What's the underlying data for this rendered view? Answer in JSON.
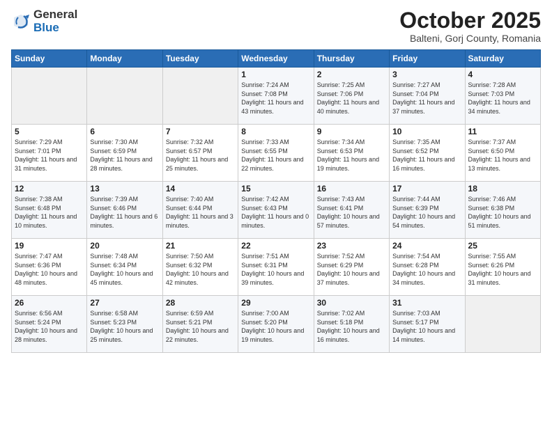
{
  "logo": {
    "general": "General",
    "blue": "Blue"
  },
  "header": {
    "month": "October 2025",
    "location": "Balteni, Gorj County, Romania"
  },
  "weekdays": [
    "Sunday",
    "Monday",
    "Tuesday",
    "Wednesday",
    "Thursday",
    "Friday",
    "Saturday"
  ],
  "weeks": [
    [
      {
        "day": "",
        "info": ""
      },
      {
        "day": "",
        "info": ""
      },
      {
        "day": "",
        "info": ""
      },
      {
        "day": "1",
        "info": "Sunrise: 7:24 AM\nSunset: 7:08 PM\nDaylight: 11 hours\nand 43 minutes."
      },
      {
        "day": "2",
        "info": "Sunrise: 7:25 AM\nSunset: 7:06 PM\nDaylight: 11 hours\nand 40 minutes."
      },
      {
        "day": "3",
        "info": "Sunrise: 7:27 AM\nSunset: 7:04 PM\nDaylight: 11 hours\nand 37 minutes."
      },
      {
        "day": "4",
        "info": "Sunrise: 7:28 AM\nSunset: 7:03 PM\nDaylight: 11 hours\nand 34 minutes."
      }
    ],
    [
      {
        "day": "5",
        "info": "Sunrise: 7:29 AM\nSunset: 7:01 PM\nDaylight: 11 hours\nand 31 minutes."
      },
      {
        "day": "6",
        "info": "Sunrise: 7:30 AM\nSunset: 6:59 PM\nDaylight: 11 hours\nand 28 minutes."
      },
      {
        "day": "7",
        "info": "Sunrise: 7:32 AM\nSunset: 6:57 PM\nDaylight: 11 hours\nand 25 minutes."
      },
      {
        "day": "8",
        "info": "Sunrise: 7:33 AM\nSunset: 6:55 PM\nDaylight: 11 hours\nand 22 minutes."
      },
      {
        "day": "9",
        "info": "Sunrise: 7:34 AM\nSunset: 6:53 PM\nDaylight: 11 hours\nand 19 minutes."
      },
      {
        "day": "10",
        "info": "Sunrise: 7:35 AM\nSunset: 6:52 PM\nDaylight: 11 hours\nand 16 minutes."
      },
      {
        "day": "11",
        "info": "Sunrise: 7:37 AM\nSunset: 6:50 PM\nDaylight: 11 hours\nand 13 minutes."
      }
    ],
    [
      {
        "day": "12",
        "info": "Sunrise: 7:38 AM\nSunset: 6:48 PM\nDaylight: 11 hours\nand 10 minutes."
      },
      {
        "day": "13",
        "info": "Sunrise: 7:39 AM\nSunset: 6:46 PM\nDaylight: 11 hours\nand 6 minutes."
      },
      {
        "day": "14",
        "info": "Sunrise: 7:40 AM\nSunset: 6:44 PM\nDaylight: 11 hours\nand 3 minutes."
      },
      {
        "day": "15",
        "info": "Sunrise: 7:42 AM\nSunset: 6:43 PM\nDaylight: 11 hours\nand 0 minutes."
      },
      {
        "day": "16",
        "info": "Sunrise: 7:43 AM\nSunset: 6:41 PM\nDaylight: 10 hours\nand 57 minutes."
      },
      {
        "day": "17",
        "info": "Sunrise: 7:44 AM\nSunset: 6:39 PM\nDaylight: 10 hours\nand 54 minutes."
      },
      {
        "day": "18",
        "info": "Sunrise: 7:46 AM\nSunset: 6:38 PM\nDaylight: 10 hours\nand 51 minutes."
      }
    ],
    [
      {
        "day": "19",
        "info": "Sunrise: 7:47 AM\nSunset: 6:36 PM\nDaylight: 10 hours\nand 48 minutes."
      },
      {
        "day": "20",
        "info": "Sunrise: 7:48 AM\nSunset: 6:34 PM\nDaylight: 10 hours\nand 45 minutes."
      },
      {
        "day": "21",
        "info": "Sunrise: 7:50 AM\nSunset: 6:32 PM\nDaylight: 10 hours\nand 42 minutes."
      },
      {
        "day": "22",
        "info": "Sunrise: 7:51 AM\nSunset: 6:31 PM\nDaylight: 10 hours\nand 39 minutes."
      },
      {
        "day": "23",
        "info": "Sunrise: 7:52 AM\nSunset: 6:29 PM\nDaylight: 10 hours\nand 37 minutes."
      },
      {
        "day": "24",
        "info": "Sunrise: 7:54 AM\nSunset: 6:28 PM\nDaylight: 10 hours\nand 34 minutes."
      },
      {
        "day": "25",
        "info": "Sunrise: 7:55 AM\nSunset: 6:26 PM\nDaylight: 10 hours\nand 31 minutes."
      }
    ],
    [
      {
        "day": "26",
        "info": "Sunrise: 6:56 AM\nSunset: 5:24 PM\nDaylight: 10 hours\nand 28 minutes."
      },
      {
        "day": "27",
        "info": "Sunrise: 6:58 AM\nSunset: 5:23 PM\nDaylight: 10 hours\nand 25 minutes."
      },
      {
        "day": "28",
        "info": "Sunrise: 6:59 AM\nSunset: 5:21 PM\nDaylight: 10 hours\nand 22 minutes."
      },
      {
        "day": "29",
        "info": "Sunrise: 7:00 AM\nSunset: 5:20 PM\nDaylight: 10 hours\nand 19 minutes."
      },
      {
        "day": "30",
        "info": "Sunrise: 7:02 AM\nSunset: 5:18 PM\nDaylight: 10 hours\nand 16 minutes."
      },
      {
        "day": "31",
        "info": "Sunrise: 7:03 AM\nSunset: 5:17 PM\nDaylight: 10 hours\nand 14 minutes."
      },
      {
        "day": "",
        "info": ""
      }
    ]
  ]
}
